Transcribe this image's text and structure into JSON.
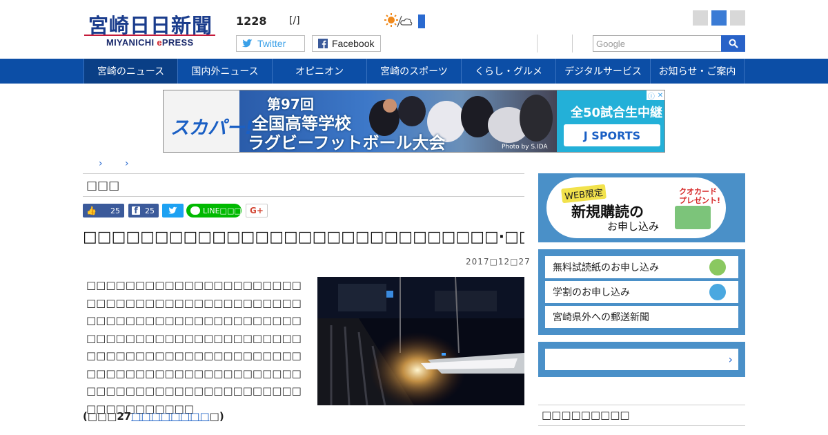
{
  "header": {
    "logo_title": "宮崎日日新聞",
    "logo_sub_prefix": "MIYANICHI ",
    "logo_sub_e": "e",
    "logo_sub_suffix": "PRESS",
    "date": "1228",
    "weekday": "[/]",
    "twitter_label": "Twitter",
    "facebook_label": "Facebook",
    "search_placeholder": "Google"
  },
  "nav": {
    "items": [
      {
        "label": "宮崎のニュース"
      },
      {
        "label": "国内外ニュース"
      },
      {
        "label": "オピニオン"
      },
      {
        "label": "宮崎のスポーツ"
      },
      {
        "label": "くらし・グルメ"
      },
      {
        "label": "デジタルサービス"
      },
      {
        "label": "お知らせ・ご案内"
      }
    ]
  },
  "banner": {
    "brand": "スカパー!",
    "line1": "第97回",
    "line2": "全国高等学校",
    "line3": "ラグビーフットボール大会",
    "credit": "Photo by S.IDA",
    "live": "全50試合生中継",
    "channel": "J SPORTS"
  },
  "breadcrumb": {
    "sep1": "›",
    "sep2": "›"
  },
  "article": {
    "section": "□□□",
    "like_count": "25",
    "share_count": "25",
    "line_label": "LINE□□□",
    "gplus": "G+",
    "headline": "□□□□□□□□□□□□□□□□□□□□□□□□□□□□□·□□",
    "date": "2017□12□27",
    "body": "□□□□□□□□□□□□□□□□□□□□□□□□□□□□□□□□□□□□□□□□□□□□□□□□□□□□□□□□□□□□□□□□□□□□□□□□□□□□□□□□□□□□□□□□□□□□□□□□□□□□□□□□□□□□□□□□□□□□□□□□□□□□□□□□□□□□□□□□□□□□□□□□□□□□□□□□□□□□□□□□□□□□□",
    "source_prefix": "(□□□27",
    "source_link": "□□□□□□□□",
    "source_suffix": "□)"
  },
  "sidebar": {
    "promo_web": "WEB限定",
    "promo_quo1": "クオカード",
    "promo_quo2": "プレゼント!",
    "promo_main": "新規購読の",
    "promo_sub": "お申し込み",
    "links": [
      {
        "label": "無料試読紙のお申し込み"
      },
      {
        "label": "学割のお申し込み"
      },
      {
        "label": "宮崎県外への郵送新聞"
      }
    ],
    "search_chevron": "›",
    "heading": "□□□□□□□□□"
  },
  "colors": {
    "nav_bg": "#0c4ea6",
    "accent": "#2862c8",
    "sidebar_bg": "#4a90c8"
  }
}
